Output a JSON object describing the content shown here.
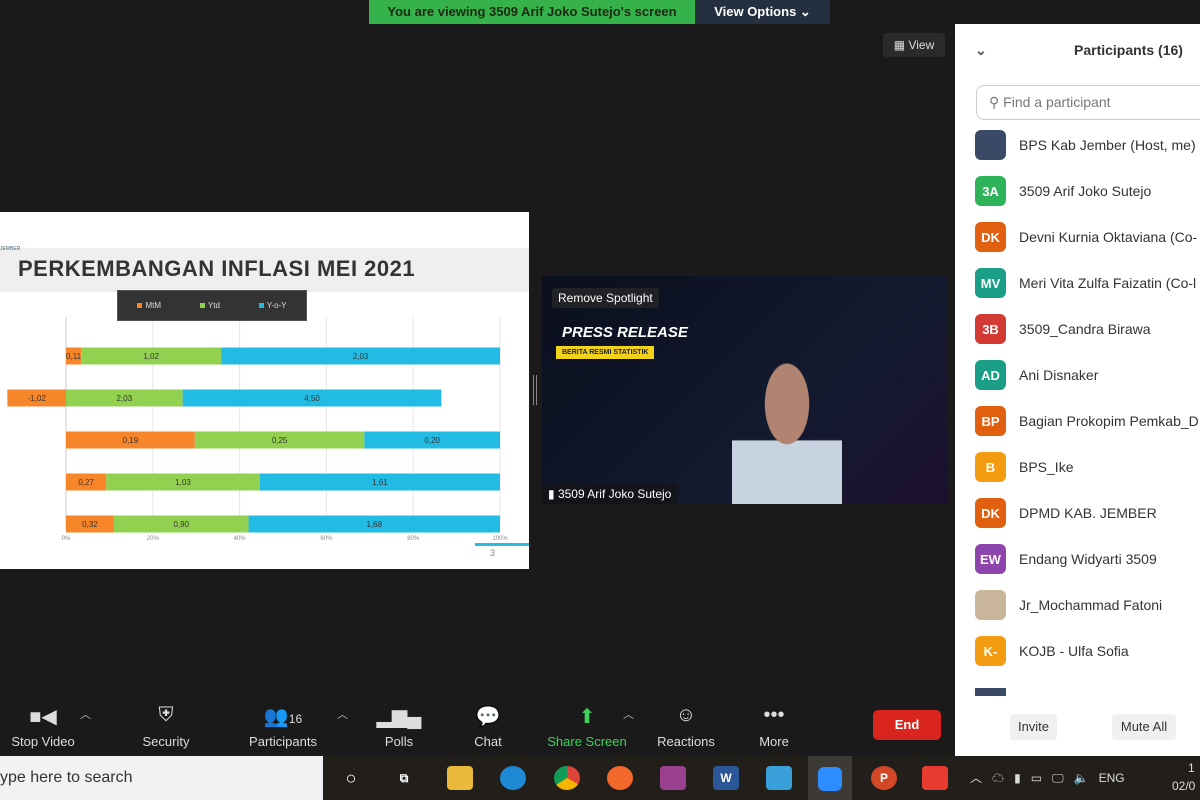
{
  "banner": {
    "viewing": "You are viewing 3509 Arif Joko Sutejo's screen",
    "view_options": "View Options ⌄"
  },
  "view_button": "▦ View",
  "slide": {
    "org_text": "JEMBER",
    "title": "PERKEMBANGAN INFLASI MEI 2021",
    "page": "3"
  },
  "chart_data": {
    "type": "bar",
    "stacked": "100%",
    "orientation": "horizontal",
    "title": "PERKEMBANGAN INFLASI MEI 2021",
    "legend": [
      "MtM",
      "Ytd",
      "Y-o-Y"
    ],
    "legend_position": "top",
    "colors": [
      "#f7862a",
      "#92d050",
      "#21bbe3"
    ],
    "series": [
      {
        "name": "MtM",
        "values": [
          0.11,
          -1.02,
          0.19,
          0.27,
          0.32
        ]
      },
      {
        "name": "Ytd",
        "values": [
          1.02,
          2.03,
          0.25,
          1.03,
          0.9
        ]
      },
      {
        "name": "Y-o-Y",
        "values": [
          2.03,
          4.5,
          0.2,
          1.61,
          1.68
        ]
      }
    ],
    "data_labels": [
      [
        "0,11",
        "1,02",
        "2,03"
      ],
      [
        "-1,02",
        "2,03",
        "4,50"
      ],
      [
        "0,19",
        "0,25",
        "0,20"
      ],
      [
        "0,27",
        "1,03",
        "1,61"
      ],
      [
        "0,32",
        "0,90",
        "1,68"
      ]
    ],
    "xticks": [
      "0%",
      "20%",
      "40%",
      "60%",
      "80%",
      "100%"
    ],
    "xlim": [
      0,
      100
    ],
    "grid": true
  },
  "video": {
    "spotlight": "Remove Spotlight",
    "press": "PRESS RELEASE",
    "brs": "BERITA RESMI STATISTIK",
    "name": "3509 Arif Joko Sutejo"
  },
  "toolbar": {
    "stop_video": "Stop Video",
    "security": "Security",
    "participants": "Participants",
    "participants_count": "16",
    "polls": "Polls",
    "chat": "Chat",
    "share": "Share Screen",
    "reactions": "Reactions",
    "more": "More",
    "end": "End"
  },
  "panel": {
    "title": "Participants (16)",
    "search_placeholder": "Find a participant",
    "invite": "Invite",
    "mute_all": "Mute All",
    "participants": [
      {
        "initials": "",
        "name": "BPS Kab Jember (Host, me)",
        "color": "#3a4a66"
      },
      {
        "initials": "3A",
        "name": "3509 Arif Joko Sutejo",
        "color": "#2fb35a"
      },
      {
        "initials": "DK",
        "name": "Devni Kurnia Oktaviana (Co-",
        "color": "#e0600f"
      },
      {
        "initials": "MV",
        "name": "Meri Vita Zulfa Faizatin (Co-l",
        "color": "#1a9e85"
      },
      {
        "initials": "3B",
        "name": "3509_Candra Birawa",
        "color": "#d23a33"
      },
      {
        "initials": "AD",
        "name": "Ani Disnaker",
        "color": "#1a9e85"
      },
      {
        "initials": "BP",
        "name": "Bagian Prokopim Pemkab_D",
        "color": "#e0600f"
      },
      {
        "initials": "B",
        "name": "BPS_Ike",
        "color": "#f39c12"
      },
      {
        "initials": "DK",
        "name": "DPMD KAB. JEMBER",
        "color": "#e0600f"
      },
      {
        "initials": "EW",
        "name": "Endang Widyarti 3509",
        "color": "#8e44ad"
      },
      {
        "initials": "",
        "name": "Jr_Mochammad Fatoni",
        "color": "#c9b59a"
      },
      {
        "initials": "K-",
        "name": "KOJB - Ulfa Sofia",
        "color": "#f39c12"
      }
    ]
  },
  "taskbar": {
    "search": "ype here to search",
    "lang": "ENG",
    "time": "1",
    "date": "02/0"
  }
}
